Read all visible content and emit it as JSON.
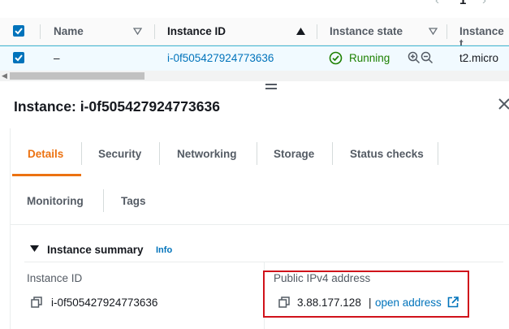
{
  "pager": {
    "current_page": "1"
  },
  "table": {
    "headers": {
      "name": "Name",
      "instance_id": "Instance ID",
      "instance_state": "Instance state",
      "instance_type": "Instance t"
    },
    "row": {
      "name": "–",
      "instance_id": "i-0f505427924773636",
      "state": "Running",
      "type": "t2.micro"
    }
  },
  "panel": {
    "title": "Instance: i-0f505427924773636",
    "tabs": [
      "Details",
      "Security",
      "Networking",
      "Storage",
      "Status checks",
      "Monitoring",
      "Tags"
    ],
    "active_tab": "Details",
    "summary": {
      "title": "Instance summary",
      "info": "Info",
      "instance_id_label": "Instance ID",
      "instance_id_value": "i-0f505427924773636",
      "ipv4_label": "Public IPv4 address",
      "ipv4_value": "3.88.177.128",
      "separator": "|",
      "open_address": "open address"
    }
  },
  "colors": {
    "accent": "#ec7211",
    "link": "#0073bb",
    "running": "#1d8102",
    "highlight_box": "#d0121b"
  }
}
